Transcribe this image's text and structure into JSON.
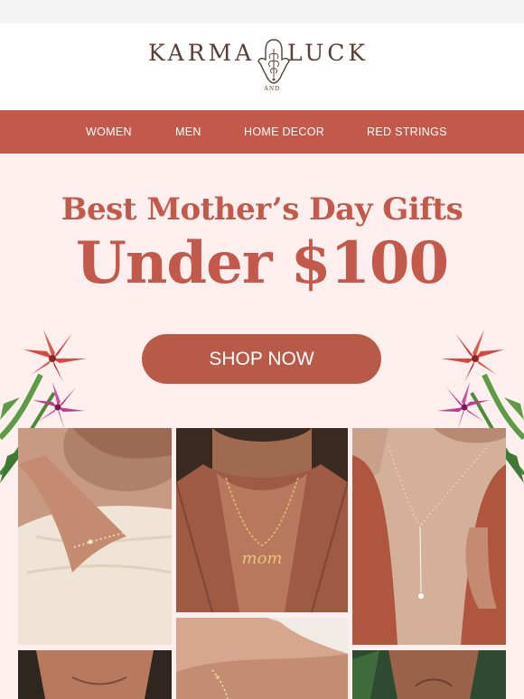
{
  "brand": {
    "name_left": "KARMA",
    "name_right": "LUCK",
    "name_middle": "AND"
  },
  "nav": {
    "items": [
      {
        "label": "WOMEN"
      },
      {
        "label": "MEN"
      },
      {
        "label": "HOME DECOR"
      },
      {
        "label": "RED STRINGS"
      }
    ]
  },
  "hero": {
    "headline": "Best Mother’s Day Gifts",
    "subheadline": "Under $100",
    "cta_label": "SHOP NOW"
  },
  "photos": {
    "necklace_pendant_text": "mom"
  },
  "colors": {
    "nav_bg": "#c2594a",
    "hero_bg": "#fdefed",
    "accent": "#c2594a",
    "button_bg": "#b85a48",
    "logo": "#5a3e33"
  },
  "icons": {
    "logo_mark": "hamsa-hand-icon"
  }
}
